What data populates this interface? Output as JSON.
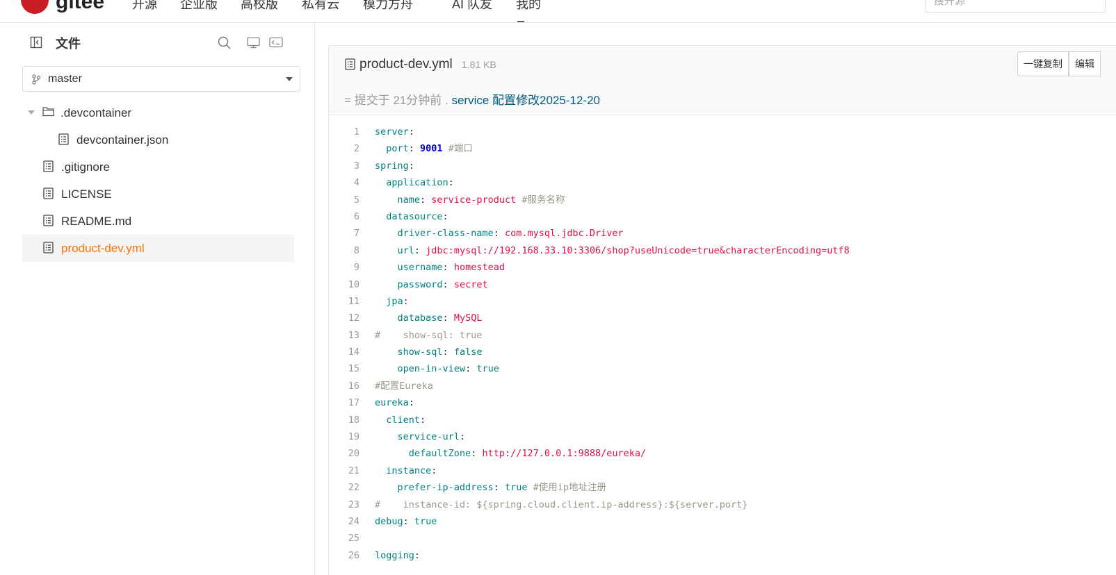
{
  "topnav": {
    "logo_text": "gitee",
    "links": [
      "开源",
      "企业版",
      "高校版",
      "私有云",
      "模力方舟",
      "AI 队友",
      "我的"
    ],
    "search_placeholder": "搜开源"
  },
  "sidebar": {
    "title": "文件",
    "branch": "master",
    "tree": [
      {
        "label": ".devcontainer",
        "type": "folder",
        "depth": 0
      },
      {
        "label": "devcontainer.json",
        "type": "file",
        "depth": 1
      },
      {
        "label": ".gitignore",
        "type": "file",
        "depth": 0
      },
      {
        "label": "LICENSE",
        "type": "file",
        "depth": 0
      },
      {
        "label": "README.md",
        "type": "file",
        "depth": 0
      },
      {
        "label": "product-dev.yml",
        "type": "file",
        "depth": 0,
        "active": true
      }
    ]
  },
  "file": {
    "name": "product-dev.yml",
    "size": "1.81 KB",
    "buttons": [
      "一键复制",
      "编辑"
    ],
    "commit_prefix": "= 提交于 21分钟前 . ",
    "commit_message": "service 配置修改2025-12-20"
  },
  "code_lines": [
    [
      [
        "k",
        "server"
      ],
      [
        "p",
        ":"
      ]
    ],
    [
      [
        "p",
        "  "
      ],
      [
        "k",
        "port"
      ],
      [
        "p",
        ": "
      ],
      [
        "n",
        "9001"
      ],
      [
        "p",
        " "
      ],
      [
        "c",
        "#端口"
      ]
    ],
    [
      [
        "k",
        "spring"
      ],
      [
        "p",
        ":"
      ]
    ],
    [
      [
        "p",
        "  "
      ],
      [
        "k",
        "application"
      ],
      [
        "p",
        ":"
      ]
    ],
    [
      [
        "p",
        "    "
      ],
      [
        "k",
        "name"
      ],
      [
        "p",
        ": "
      ],
      [
        "s",
        "service-product"
      ],
      [
        "p",
        " "
      ],
      [
        "c",
        "#服务名称"
      ]
    ],
    [
      [
        "p",
        "  "
      ],
      [
        "k",
        "datasource"
      ],
      [
        "p",
        ":"
      ]
    ],
    [
      [
        "p",
        "    "
      ],
      [
        "k",
        "driver-class-name"
      ],
      [
        "p",
        ": "
      ],
      [
        "s",
        "com.mysql.jdbc.Driver"
      ]
    ],
    [
      [
        "p",
        "    "
      ],
      [
        "k",
        "url"
      ],
      [
        "p",
        ": "
      ],
      [
        "s",
        "jdbc:mysql://192.168.33.10:3306/shop?useUnicode=true&characterEncoding=utf8"
      ]
    ],
    [
      [
        "p",
        "    "
      ],
      [
        "k",
        "username"
      ],
      [
        "p",
        ": "
      ],
      [
        "s",
        "homestead"
      ]
    ],
    [
      [
        "p",
        "    "
      ],
      [
        "k",
        "password"
      ],
      [
        "p",
        ": "
      ],
      [
        "s",
        "secret"
      ]
    ],
    [
      [
        "p",
        "  "
      ],
      [
        "k",
        "jpa"
      ],
      [
        "p",
        ":"
      ]
    ],
    [
      [
        "p",
        "    "
      ],
      [
        "k",
        "database"
      ],
      [
        "p",
        ": "
      ],
      [
        "s",
        "MySQL"
      ]
    ],
    [
      [
        "c",
        "#    show-sql: true"
      ]
    ],
    [
      [
        "p",
        "    "
      ],
      [
        "k",
        "show-sql"
      ],
      [
        "p",
        ": "
      ],
      [
        "k",
        "false"
      ]
    ],
    [
      [
        "p",
        "    "
      ],
      [
        "k",
        "open-in-view"
      ],
      [
        "p",
        ": "
      ],
      [
        "k",
        "true"
      ]
    ],
    [
      [
        "c",
        "#配置Eureka"
      ]
    ],
    [
      [
        "k",
        "eureka"
      ],
      [
        "p",
        ":"
      ]
    ],
    [
      [
        "p",
        "  "
      ],
      [
        "k",
        "client"
      ],
      [
        "p",
        ":"
      ]
    ],
    [
      [
        "p",
        "    "
      ],
      [
        "k",
        "service-url"
      ],
      [
        "p",
        ":"
      ]
    ],
    [
      [
        "p",
        "      "
      ],
      [
        "k",
        "defaultZone"
      ],
      [
        "p",
        ": "
      ],
      [
        "s",
        "http://127.0.0.1:9888/eureka/"
      ]
    ],
    [
      [
        "p",
        "  "
      ],
      [
        "k",
        "instance"
      ],
      [
        "p",
        ":"
      ]
    ],
    [
      [
        "p",
        "    "
      ],
      [
        "k",
        "prefer-ip-address"
      ],
      [
        "p",
        ": "
      ],
      [
        "k",
        "true"
      ],
      [
        "p",
        " "
      ],
      [
        "c",
        "#使用ip地址注册"
      ]
    ],
    [
      [
        "c",
        "#    instance-id: ${spring.cloud.client.ip-address}:${server.port}"
      ]
    ],
    [
      [
        "k",
        "debug"
      ],
      [
        "p",
        ": "
      ],
      [
        "k",
        "true"
      ]
    ],
    [],
    [
      [
        "k",
        "logging"
      ],
      [
        "p",
        ":"
      ]
    ]
  ]
}
